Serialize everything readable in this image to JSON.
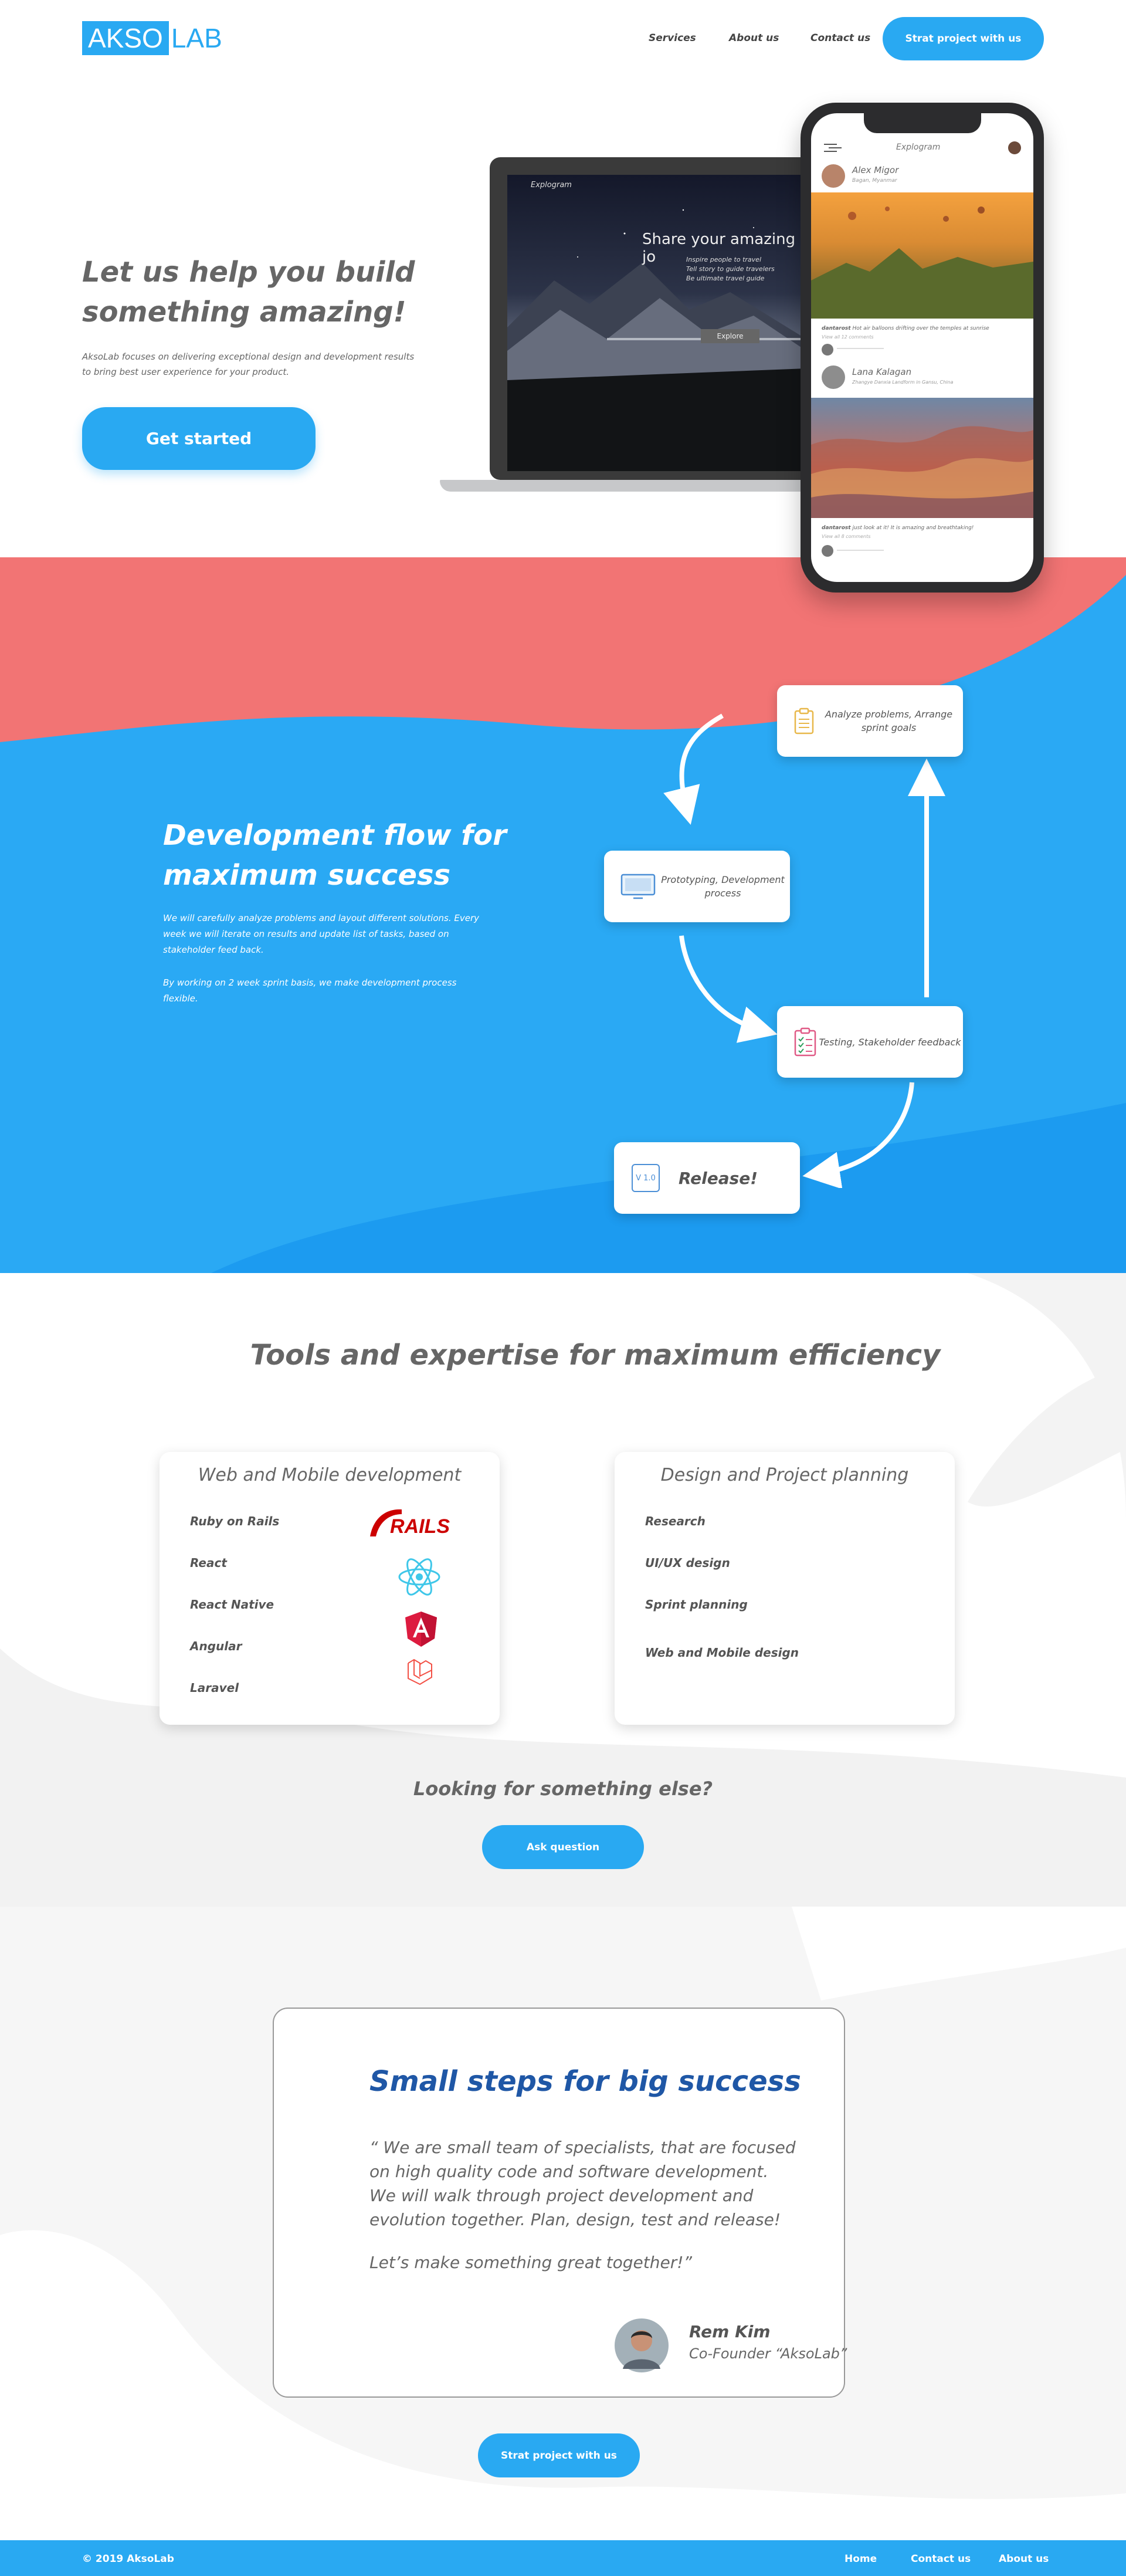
{
  "header": {
    "logo_part1": "AKSO",
    "logo_part2": "LAB",
    "nav": [
      "Services",
      "About us",
      "Contact us"
    ],
    "cta": "Strat project with us"
  },
  "hero": {
    "title": "Let us help you build something amazing!",
    "subtitle": "AksoLab focuses on delivering exceptional design and development results to bring best user experience for your product.",
    "button": "Get started",
    "laptop": {
      "app_name": "Explogram",
      "headline": "Share your amazing jo",
      "lines": [
        "Inspire people to travel",
        "Tell story to guide travelers",
        "Be ultimate travel guide"
      ],
      "button": "Explore"
    },
    "phone": {
      "app_name": "Explogram",
      "posts": [
        {
          "name": "Alex Migor",
          "place": "Bagan, Myanmar",
          "caption": "Hot air balloons drifting over the temples at sunrise",
          "user": "dantarost",
          "meta": "View all 12 comments"
        },
        {
          "name": "Lana Kalagan",
          "place": "Zhangye Danxia Landform in Gansu, China",
          "caption": "just look at it! It is amazing and breathtaking!",
          "user": "dantarost",
          "meta": "View all 8 comments"
        }
      ]
    }
  },
  "flow": {
    "title": "Development flow for maximum success",
    "text1": "We will carefully analyze problems and layout different solutions. Every week we will iterate on results and update list of tasks, based on stakeholder feed back.",
    "text2": "By working on 2 week sprint basis, we make development process flexible.",
    "steps": {
      "analyze": "Analyze problems, Arrange sprint goals",
      "prototype": "Prototyping, Development process",
      "testing": "Testing, Stakeholder feedback",
      "release": "Release!",
      "release_badge": "V 1.0"
    }
  },
  "tools": {
    "title": "Tools and expertise for maximum efficiency",
    "web": {
      "title": "Web and Mobile development",
      "items": [
        "Ruby on Rails",
        "React",
        "React Native",
        "Angular",
        "Laravel"
      ],
      "rails_logo": "RAILS"
    },
    "design": {
      "title": "Design and Project planning",
      "items": [
        "Research",
        "UI/UX design",
        "Sprint planning",
        "Web and Mobile design"
      ]
    },
    "else_title": "Looking for something else?",
    "ask_button": "Ask question"
  },
  "quote": {
    "title": "Small steps for big success",
    "text": "“ We are small team of specialists, that are focused on high quality code and software development. We will walk through project development and evolution together. Plan, design, test and release!",
    "closing": "Let’s make something great together!”",
    "author": "Rem Kim",
    "role": "Co-Founder “AksoLab”",
    "cta": "Strat project with us"
  },
  "footer": {
    "copyright": "© 2019 AksoLab",
    "links": [
      "Home",
      "Contact us",
      "About us"
    ]
  },
  "colors": {
    "brand_blue": "#29a9f2",
    "coral": "#f27474",
    "deep_blue": "#1f57a6"
  }
}
